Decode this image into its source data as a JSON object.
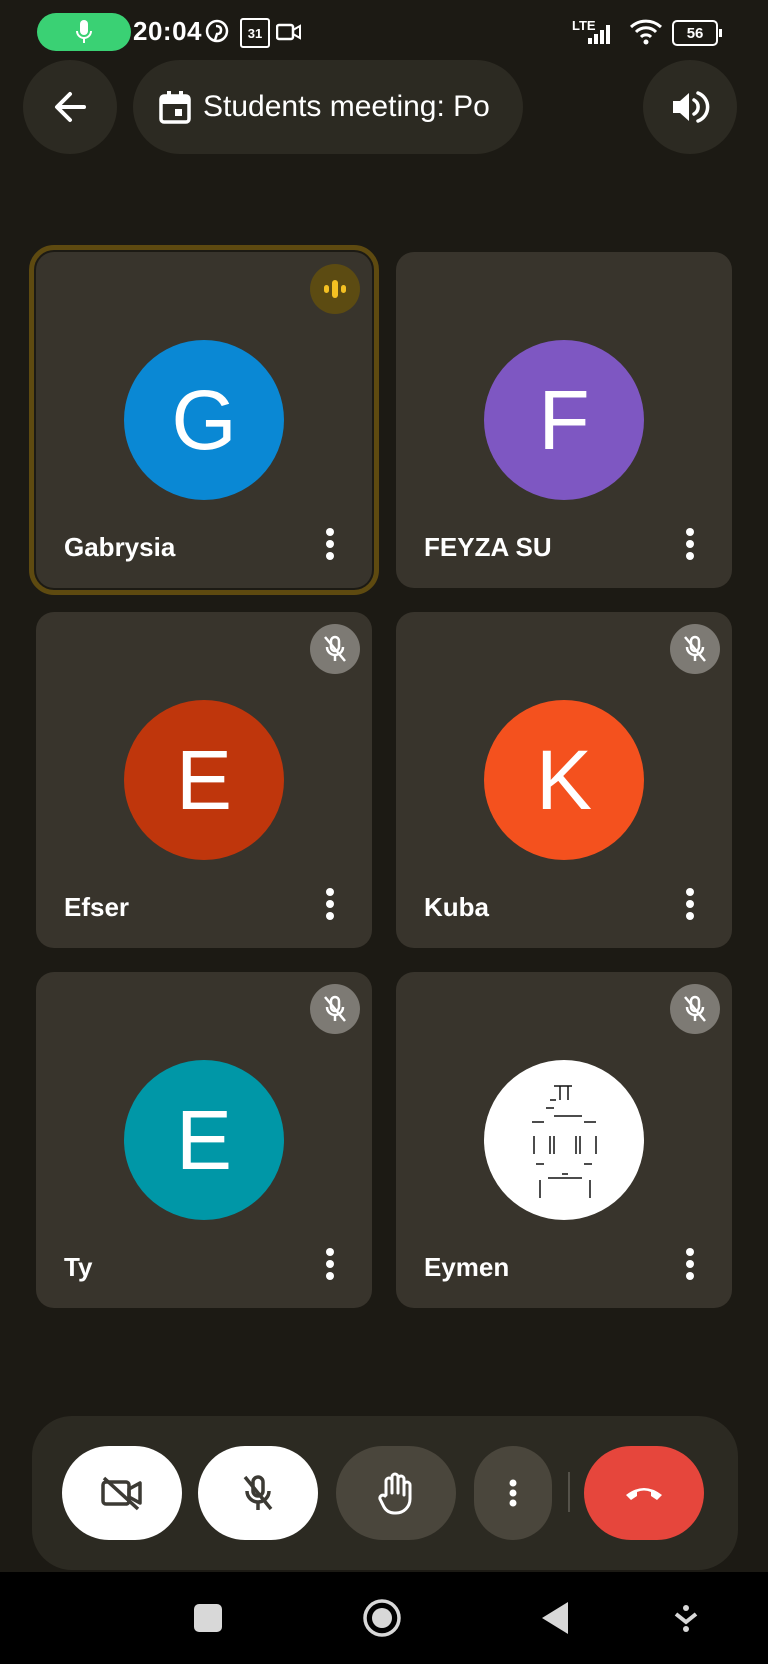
{
  "status_bar": {
    "time": "20:04",
    "calendar_day": "31",
    "network": "LTE",
    "battery": "56"
  },
  "header": {
    "title": "Students meeting: Po"
  },
  "participants": [
    {
      "initial": "G",
      "name": "Gabrysia",
      "color": "#0a88d4",
      "state": "speaking"
    },
    {
      "initial": "F",
      "name": "FEYZA SU",
      "color": "#7e57c2",
      "state": "none"
    },
    {
      "initial": "E",
      "name": "Efser",
      "color": "#bf360c",
      "state": "muted"
    },
    {
      "initial": "K",
      "name": "Kuba",
      "color": "#f4511e",
      "state": "muted"
    },
    {
      "initial": "E",
      "name": "Ty",
      "color": "#0097a7",
      "state": "muted"
    },
    {
      "initial": "",
      "name": "Eymen",
      "color": "#ffffff",
      "state": "muted"
    }
  ],
  "colors": {
    "background": "#1c1a14",
    "tile": "#38342c",
    "accent_mic": "#3ad174",
    "end_call": "#e6463c",
    "speaking_outline": "#5e4a10"
  },
  "icons": {
    "back": "arrow-left-icon",
    "calendar": "calendar-icon",
    "speaker": "speaker-icon",
    "camera_off": "video-off-icon",
    "mic_off": "mic-off-icon",
    "raise_hand": "hand-icon",
    "more": "more-vert-icon",
    "end_call": "phone-hangup-icon"
  }
}
